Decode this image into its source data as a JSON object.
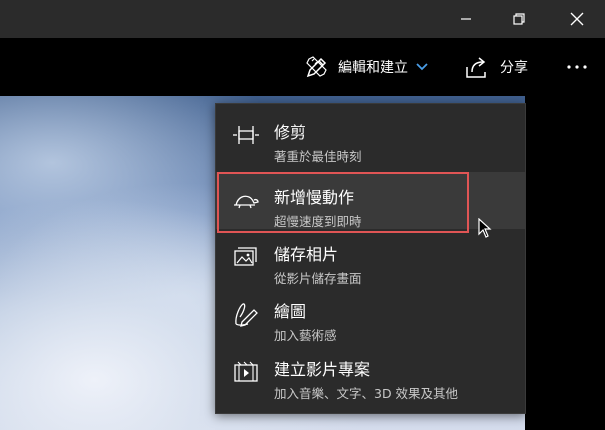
{
  "toolbar": {
    "edit_create_label": "編輯和建立",
    "share_label": "分享"
  },
  "menu": {
    "items": [
      {
        "icon": "trim-icon",
        "title": "修剪",
        "subtitle": "著重於最佳時刻"
      },
      {
        "icon": "slow-motion-icon",
        "title": "新增慢動作",
        "subtitle": "超慢速度到即時"
      },
      {
        "icon": "save-photo-icon",
        "title": "儲存相片",
        "subtitle": "從影片儲存畫面"
      },
      {
        "icon": "draw-icon",
        "title": "繪圖",
        "subtitle": "加入藝術感"
      },
      {
        "icon": "video-project-icon",
        "title": "建立影片專案",
        "subtitle": "加入音樂、文字、3D 效果及其他"
      }
    ],
    "highlighted_index": 1
  },
  "colors": {
    "menu_bg": "#2b2b2b",
    "highlight_border": "#e05555",
    "accent_chevron": "#4a9ee8"
  }
}
